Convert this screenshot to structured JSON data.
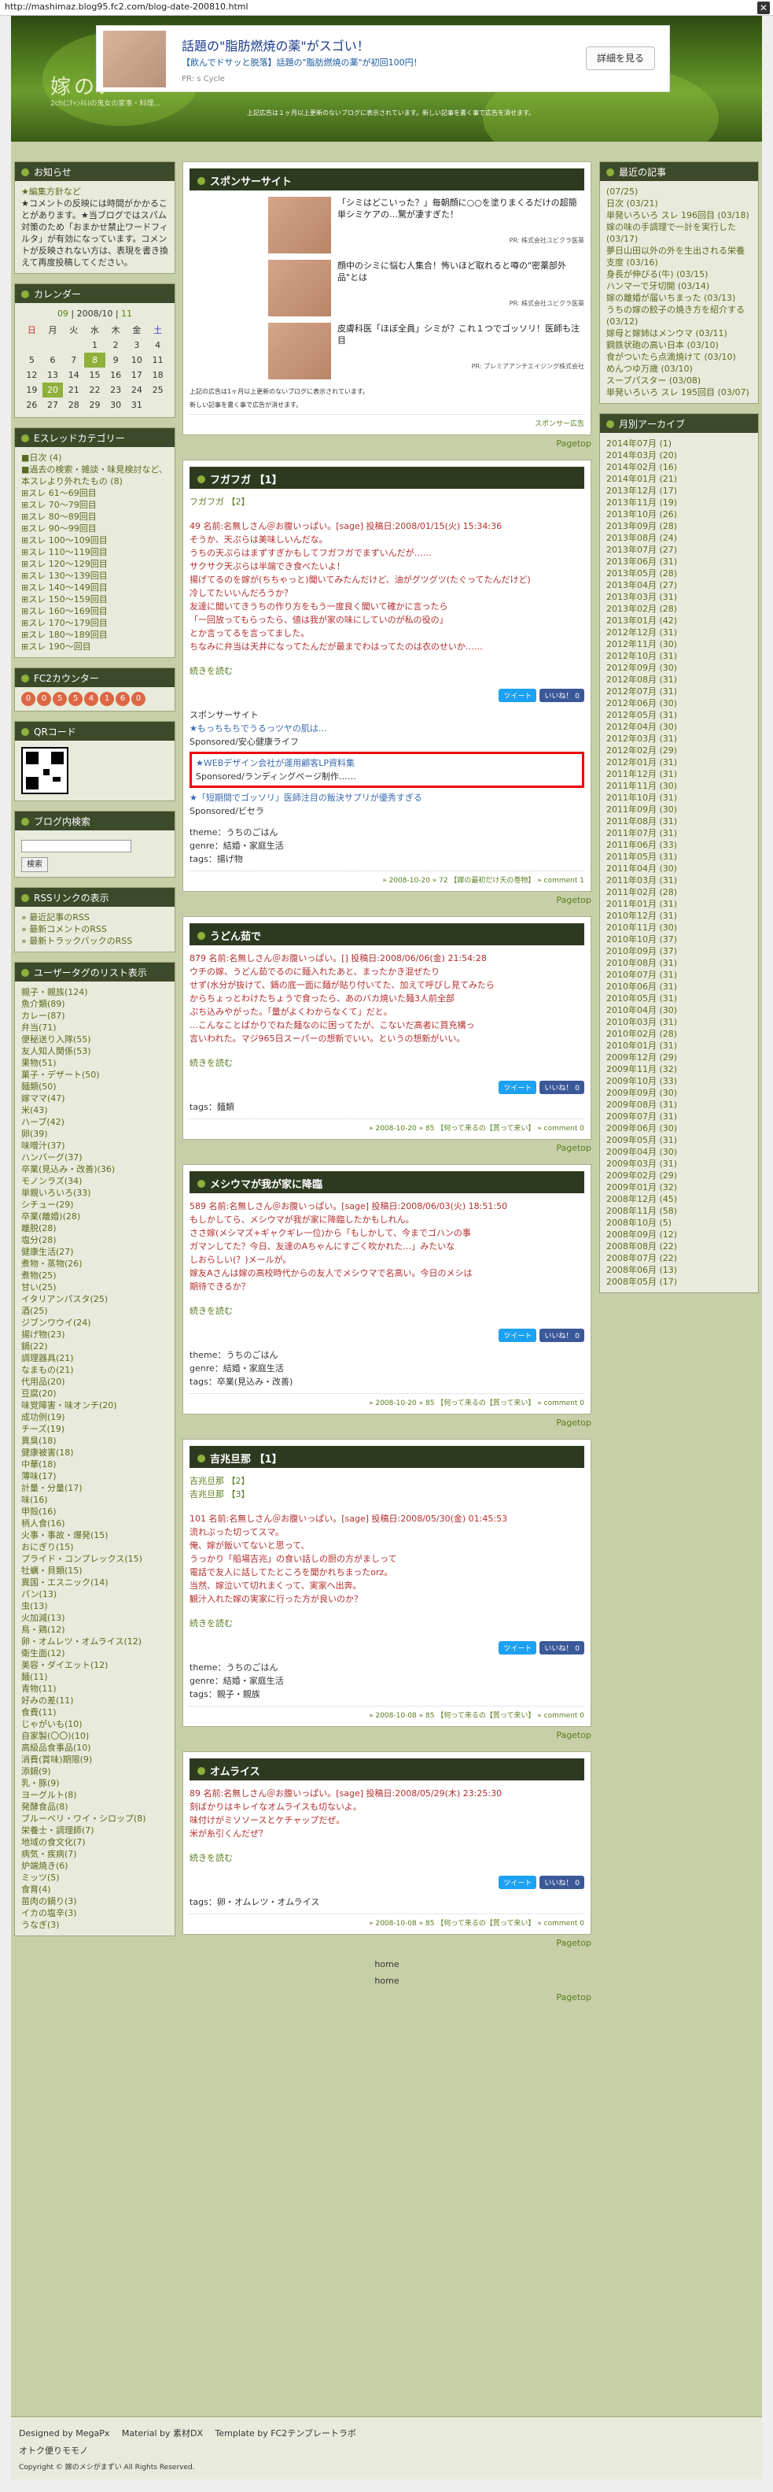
{
  "url": "http://mashimaz.blog95.fc2.com/blog-date-200810.html",
  "header": {
    "title": "嫁のメ",
    "subtitle": "2ch(ﾆﾁｬﾝﾈﾙ)の鬼女の家事・料理…",
    "topline": "上記広告は１ヶ月以上更新のないブログに表示されています。新しい記事を書く事で広告を消せます。"
  },
  "ad": {
    "headline": "話題の\"脂肪燃焼の薬\"がスゴい！",
    "sub": "【飲んでドサッと脱落】話題の\"脂肪燃焼の薬\"が初回100円！",
    "pr": "PR: s Cycle",
    "button": "詳細を見る"
  },
  "left": {
    "notice_title": "お知らせ",
    "notice": [
      "★編集方針など",
      "★コメントの反映には時間がかかることがあります。★当ブログではスパム対策のため「おまかせ禁止ワードフィルタ」が有効になっています。コメントが反映されない方は、表現を書き換えて再度投稿してください。"
    ],
    "calendar_title": "カレンダー",
    "calendar_head": [
      "09",
      "2008/10",
      "11"
    ],
    "weekdays": [
      "日",
      "月",
      "火",
      "水",
      "木",
      "金",
      "土"
    ],
    "weeks": [
      [
        "",
        "",
        "",
        "1",
        "2",
        "3",
        "4"
      ],
      [
        "5",
        "6",
        "7",
        "8",
        "9",
        "10",
        "11"
      ],
      [
        "12",
        "13",
        "14",
        "15",
        "16",
        "17",
        "18"
      ],
      [
        "19",
        "20",
        "21",
        "22",
        "23",
        "24",
        "25"
      ],
      [
        "26",
        "27",
        "28",
        "29",
        "30",
        "31",
        ""
      ]
    ],
    "category_title": "Eスレッドカテゴリー",
    "categories": [
      "■日次 (4)",
      "■過去の検索・雑談・味見検討など、本スレより外れたもの (8)",
      "⊞スレ 61〜69回目",
      "⊞スレ 70〜79回目",
      "⊞スレ 80〜89回目",
      "⊞スレ 90〜99回目",
      "⊞スレ 100〜109回目",
      "⊞スレ 110〜119回目",
      "⊞スレ 120〜129回目",
      "⊞スレ 130〜139回目",
      "⊞スレ 140〜149回目",
      "⊞スレ 150〜159回目",
      "⊞スレ 160〜169回目",
      "⊞スレ 170〜179回目",
      "⊞スレ 180〜189回目",
      "⊞スレ 190〜回目"
    ],
    "counter_title": "FC2カウンター",
    "counter": [
      "0",
      "0",
      "5",
      "5",
      "4",
      "1",
      "6",
      "0"
    ],
    "qr_title": "QRコード",
    "search_title": "ブログ内検索",
    "search_button": "検索",
    "rss_title": "RSSリンクの表示",
    "rss": [
      "» 最近記事のRSS",
      "» 最新コメントのRSS",
      "» 最新トラックバックのRSS"
    ],
    "user_title": "ユーザータグのリスト表示",
    "tags": [
      "親子・親族(124)",
      "魚介類(89)",
      "カレー(87)",
      "弁当(71)",
      "便秘送り入隊(55)",
      "友人知人関係(53)",
      "果物(51)",
      "菓子・デザート(50)",
      "麺類(50)",
      "嫁ママ(47)",
      "米(43)",
      "ハーブ(42)",
      "卵(39)",
      "味噌汁(37)",
      "ハンバーグ(37)",
      "卒業(見込み・改善)(36)",
      "モノンラズ(34)",
      "単親いろいろ(33)",
      "シチュー(29)",
      "卒業(離婚)(28)",
      "離脱(28)",
      "塩分(28)",
      "健康生活(27)",
      "煮物・蒸物(26)",
      "煮物(25)",
      "甘い(25)",
      "イタリアンパスタ(25)",
      "酒(25)",
      "ジブンワウイ(24)",
      "揚げ物(23)",
      "鍋(22)",
      "調理器具(21)",
      "なまもの(21)",
      "代用品(20)",
      "豆腐(20)",
      "味覚障害・味オンチ(20)",
      "成功例(19)",
      "チーズ(19)",
      "異臭(18)",
      "健康被害(18)",
      "中華(18)",
      "薄味(17)",
      "計量・分量(17)",
      "味(16)",
      "甲殻(16)",
      "柄人食(16)",
      "火事・事故・爆発(15)",
      "おにぎり(15)",
      "プライド・コンプレックス(15)",
      "牡蠣・貝類(15)",
      "異国・エスニック(14)",
      "パン(13)",
      "虫(13)",
      "火加減(13)",
      "鳥・鶏(12)",
      "卵・オムレツ・オムライス(12)",
      "衛生面(12)",
      "美容・ダイエット(12)",
      "麺(11)",
      "青物(11)",
      "好みの差(11)",
      "食費(11)",
      "じゃがいも(10)",
      "自家製(〇〇)(10)",
      "高級品食事品(10)",
      "消費(賞味)期限(9)",
      "添鍋(9)",
      "乳・豚(9)",
      "ヨーグルト(8)",
      "発酵食品(8)",
      "ブルーベリ・ワイ・シロップ(8)",
      "栄養士・調理師(7)",
      "地域の食文化(7)",
      "病気・疾病(7)",
      "炉端焼き(6)",
      "ミッツ(5)",
      "食育(4)",
      "苗肉の鍋り(3)",
      "イカの塩辛(3)",
      "うなぎ(3)"
    ]
  },
  "right": {
    "recent_title": "最近の記事",
    "recent": [
      "(07/25)",
      "日次 (03/21)",
      "単発いろいろ スレ 196回目 (03/18)",
      "嫁の味の手調理で一計を実行した (03/17)",
      "夢日山田以外の外を生出される栄養支度 (03/16)",
      "身長が伸びる(牛) (03/15)",
      "ハンマーで牙切開 (03/14)",
      "嫁の離婚が届いちまった (03/13)",
      "うちの嫁の餃子の焼き方を紹介する (03/12)",
      "嫁母と嫁姉はメンウマ (03/11)",
      "鋼鉄状砲の高い日本 (03/10)",
      "食がついたら点滴焼けて (03/10)",
      "めんつゆ万歳 (03/10)",
      "スープパスター (03/08)",
      "単発いろいろ スレ 195回目 (03/07)"
    ],
    "archive_title": "月別アーカイブ",
    "archive": [
      "2014年07月 (1)",
      "2014年03月 (20)",
      "2014年02月 (16)",
      "2014年01月 (21)",
      "2013年12月 (17)",
      "2013年11月 (19)",
      "2013年10月 (26)",
      "2013年09月 (28)",
      "2013年08月 (24)",
      "2013年07月 (27)",
      "2013年06月 (31)",
      "2013年05月 (28)",
      "2013年04月 (27)",
      "2013年03月 (31)",
      "2013年02月 (28)",
      "2013年01月 (42)",
      "2012年12月 (31)",
      "2012年11月 (30)",
      "2012年10月 (31)",
      "2012年09月 (30)",
      "2012年08月 (31)",
      "2012年07月 (31)",
      "2012年06月 (30)",
      "2012年05月 (31)",
      "2012年04月 (30)",
      "2012年03月 (31)",
      "2012年02月 (29)",
      "2012年01月 (31)",
      "2011年12月 (31)",
      "2011年11月 (30)",
      "2011年10月 (31)",
      "2011年09月 (30)",
      "2011年08月 (31)",
      "2011年07月 (31)",
      "2011年06月 (33)",
      "2011年05月 (31)",
      "2011年04月 (30)",
      "2011年03月 (31)",
      "2011年02月 (28)",
      "2011年01月 (31)",
      "2010年12月 (31)",
      "2010年11月 (30)",
      "2010年10月 (37)",
      "2010年09月 (37)",
      "2010年08月 (31)",
      "2010年07月 (31)",
      "2010年06月 (31)",
      "2010年05月 (31)",
      "2010年04月 (30)",
      "2010年03月 (31)",
      "2010年02月 (28)",
      "2010年01月 (31)",
      "2009年12月 (29)",
      "2009年11月 (32)",
      "2009年10月 (33)",
      "2009年09月 (30)",
      "2009年08月 (31)",
      "2009年07月 (31)",
      "2009年06月 (30)",
      "2009年05月 (31)",
      "2009年04月 (30)",
      "2009年03月 (31)",
      "2009年02月 (29)",
      "2009年01月 (32)",
      "2008年12月 (45)",
      "2008年11月 (58)",
      "2008年10月 (5)",
      "2008年09月 (12)",
      "2008年08月 (22)",
      "2008年07月 (22)",
      "2008年06月 (13)",
      "2008年05月 (17)"
    ]
  },
  "sponsor": {
    "title": "スポンサーサイト",
    "items": [
      {
        "text": "「シミはどこいった？」毎朝顔に○○を塗りまくるだけの超簡単シミケアの…驚が凄すぎた！",
        "src": "PR: 株式会社ユビクラ医薬"
      },
      {
        "text": "顔中のシミに悩む人集合！怖いほど取れると噂の\"密薬部外品\"とは",
        "src": "PR: 株式会社ユビクラ医薬"
      },
      {
        "text": "皮膚科医「ほぼ全員」シミが？これ１つでゴッソリ！医師も注目",
        "src": "PR: プレミアアンチエイジング株式会社"
      }
    ],
    "note1": "上記の広告は1ヶ月以上更新のないブログに表示されています。",
    "note2": "新しい記事を書く事で広告が消せます。",
    "link": "スポンサー広告"
  },
  "pagetop": "Pagetop",
  "entries": [
    {
      "title": "フガフガ 【1】",
      "sub": "フガフガ 【2】",
      "lines": [
        "49 名前:名無しさん＠お腹いっぱい。[sage] 投稿日:2008/01/15(火) 15:34:36",
        "そうか、天ぷらは美味しいんだな。",
        "うちの天ぷらはまずすぎかもしてフガフガでまずいんだが……",
        "サクサク天ぷらは半端でき食べたいよ！",
        "揚げてるのを嫁が(ちちゃっと)聞いてみたんだけど、油がグツグツ(たぐってたんだけど)",
        "冷してたいいんだろうか？",
        "友達に聞いてきうちの作り方をもう一度良く聞いて確かに言ったら",
        "「一回放ってもらったら、値は我が家の味にしていのが私の役の」",
        "とか言ってるを言ってました。",
        "ちなみに弁当は天井になってたんだが最までわはってたのは衣のせいか……"
      ],
      "readmore": "続きを読む",
      "sponsor_label": "スポンサーサイト",
      "sponsor_links": [
        {
          "text": "★もっちもちでうるっツヤの肌は…",
          "sub": "Sponsored/安心健康ライフ"
        },
        {
          "text": "★WEBデザイン会社が運用顧客LP資料集",
          "sub": "Sponsored/ランディングページ制作……"
        },
        {
          "text": "★「短期間でゴッソリ」医師注目の飯決サプリが優秀すぎる",
          "sub": "Sponsored/ビセラ"
        }
      ],
      "theme": "theme：うちのごはん",
      "genre": "genre：結婚・家庭生活",
      "tags": "tags：揚げ物",
      "meta": "» 2008-10-20 » 72 【嫁の最初だけ天の巻物】 » comment 1"
    },
    {
      "title": "うどん茹で",
      "lines": [
        "879 名前:名無しさん＠お腹いっぱい。[] 投稿日:2008/06/06(金) 21:54:28",
        "ウチの嫁、うどん茹でるのに麺入れたあと、まったかき混ぜたり",
        "せず(水分が抜けて、鍋の底一面に麺が貼り付いてた、加えて呼びし見てみたら",
        "からちょっとわけたちょうで食ったら、あのバカ焼いた麺3人前全部",
        "ぷち込みやがった。「量がよくわからなくて」だと。",
        "…こんなことばかりでねた麺なのに困ってたが、こないだ高者に買充構っ",
        "言いわれた。マジ965日スーパーの想新でいい。というの想新がいい。"
      ],
      "readmore": "続きを読む",
      "tags": "tags：麺類",
      "meta": "» 2008-10-20 » 85 【何って来るの【質って来い】 » comment 0"
    },
    {
      "title": "メシウマが我が家に降臨",
      "lines": [
        "589 名前:名無しさん＠お腹いっぱい。[sage] 投稿日:2008/06/03(火) 18:51:50",
        "もしかしてら、メシウマが我が家に降臨したかもしれん。",
        "ささ嫁(メシマズ+ギャクギレ一位)から「もしかして、今までゴハンの事",
        "ガマンしてた？今日、友達のAちゃんにすごく吹かれた…」みたいな",
        "しおらしい(？)メールが。",
        "嫁友Aさんは嫁の高校時代からの友人でメシウマで名高い。今日のメシは",
        "期待できるか？"
      ],
      "readmore": "続きを読む",
      "theme": "theme：うちのごはん",
      "genre": "genre：結婚・家庭生活",
      "tags": "tags：卒業(見込み・改善)",
      "meta": "» 2008-10-20 » 85 【何って来るの【質って来い】 » comment 0"
    },
    {
      "title": "吉兆旦那 【1】",
      "subs": [
        "吉兆旦那 【2】",
        "吉兆旦那 【3】"
      ],
      "lines": [
        "101 名前:名無しさん＠お腹いっぱい。[sage] 投稿日:2008/05/30(金) 01:45:53",
        "流れぶった切ってスマ。",
        "",
        "俺、嫁が飯いてないと思って、",
        "うっかり「船場吉兆」の食い話しの厨の方がましって",
        "電話で友人に話してたところを聞かれちまったorz。",
        "当然、嫁泣いて切れまくって、実家へ出奔。",
        "観汁入れた嫁の実家に行った方が良いのか？"
      ],
      "readmore": "続きを読む",
      "theme": "theme：うちのごはん",
      "genre": "genre：結婚・家庭生活",
      "tags": "tags：親子・親族",
      "meta": "» 2008-10-08 » 85 【何って来るの【質って来い】 » comment 0"
    },
    {
      "title": "オムライス",
      "lines": [
        "89 名前:名無しさん＠お腹いっぱい。[sage] 投稿日:2008/05/29(木) 23:25:30",
        "刻ばかりはキレイなオムライスも切ないよ。",
        "味付けがミソソースとケチャップだぜ。",
        "米が糸引くんだぜ？"
      ],
      "readmore": "続きを読む",
      "tags": "tags：卵・オムレツ・オムライス",
      "meta": "» 2008-10-08 » 85 【何って来るの【質って来い】 » comment 0"
    }
  ],
  "home": "home",
  "share": {
    "tweet": "ツイート",
    "like": "いいね！ 0"
  },
  "footer": {
    "designed": "Designed by MegaPx",
    "material": "Material by 素材DX",
    "template": "Template by FC2テンプレートラボ",
    "site": "オトク便りモモノ",
    "copy": "Copyright © 嫁のメシがまずい All Rights Reserved."
  }
}
